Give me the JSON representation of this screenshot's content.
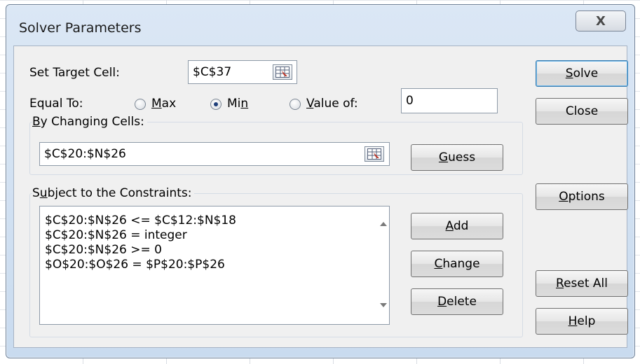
{
  "window": {
    "title": "Solver Parameters",
    "close_glyph": "X"
  },
  "target": {
    "label": "Set Target Cell:",
    "value": "$C$37"
  },
  "equal_to": {
    "label": "Equal To:",
    "options": [
      {
        "pre": "",
        "key": "M",
        "post": "ax",
        "selected": false
      },
      {
        "pre": "Mi",
        "key": "n",
        "post": "",
        "selected": true
      },
      {
        "pre": "",
        "key": "V",
        "post": "alue of:",
        "selected": false
      }
    ],
    "value_of": "0"
  },
  "changing": {
    "label_key": "B",
    "label_rest": "y Changing Cells:",
    "value": "$C$20:$N$26",
    "guess_key": "G",
    "guess_rest": "uess"
  },
  "constraints": {
    "label_pre": "S",
    "label_key": "u",
    "label_rest": "bject to the Constraints:",
    "items": [
      "$C$20:$N$26 <= $C$12:$N$18",
      "$C$20:$N$26 = integer",
      "$C$20:$N$26 >= 0",
      "$O$20:$O$26 = $P$20:$P$26"
    ],
    "add_key": "A",
    "add_rest": "dd",
    "change_key": "C",
    "change_rest": "hange",
    "delete_key": "D",
    "delete_rest": "elete"
  },
  "side_buttons": {
    "solve_key": "S",
    "solve_rest": "olve",
    "close": "Close",
    "options_key": "O",
    "options_rest": "ptions",
    "reset_key": "R",
    "reset_rest": "eset All",
    "help_key": "H",
    "help_rest": "elp"
  }
}
